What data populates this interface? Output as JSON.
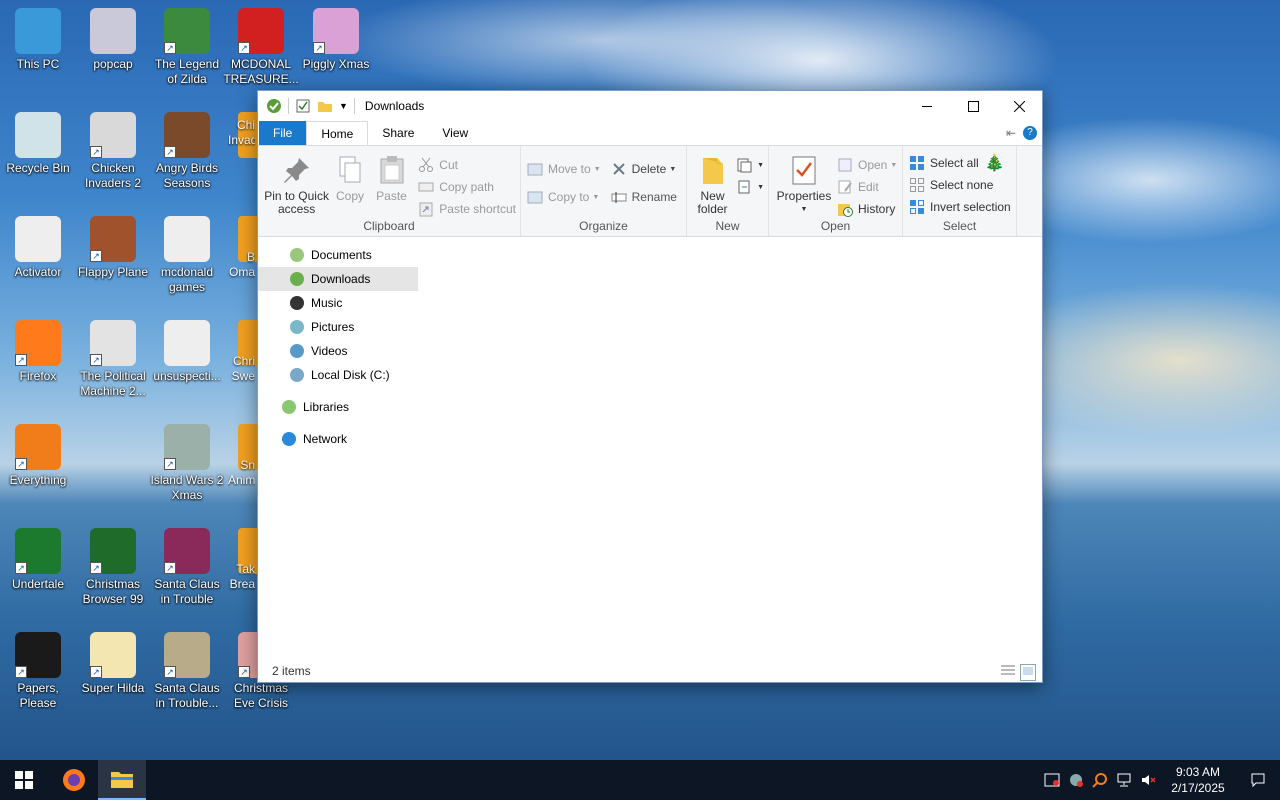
{
  "desktop": {
    "icons": [
      {
        "label": "This PC",
        "color": "#3a9ad9",
        "shortcut": false
      },
      {
        "label": "popcap",
        "color": "#c9c9d9",
        "shortcut": false
      },
      {
        "label": "The Legend of Zilda",
        "color": "#3b8a3e",
        "shortcut": true
      },
      {
        "label": "MCDONAL TREASURE...",
        "color": "#d21f1f",
        "shortcut": true
      },
      {
        "label": "Piggly Xmas",
        "color": "#d9a1d6",
        "shortcut": true
      },
      {
        "label": "Recycle Bin",
        "color": "#cfe3e8",
        "shortcut": false
      },
      {
        "label": "Chicken Invaders 2",
        "color": "#d9d9d9",
        "shortcut": true
      },
      {
        "label": "Angry Birds Seasons",
        "color": "#7a4a2a",
        "shortcut": true
      },
      {
        "label": "Activator",
        "color": "#eeeeee",
        "shortcut": false
      },
      {
        "label": "Flappy Plane",
        "color": "#a0522d",
        "shortcut": true
      },
      {
        "label": "mcdonald games",
        "color": "#eeeeee",
        "shortcut": false
      },
      {
        "label": "Firefox",
        "color": "#ff7a1a",
        "shortcut": true
      },
      {
        "label": "The Political Machine 2...",
        "color": "#e3e3e3",
        "shortcut": true
      },
      {
        "label": "unsuspecti...",
        "color": "#eeeeee",
        "shortcut": false
      },
      {
        "label": "Everything",
        "color": "#f07c1a",
        "shortcut": true
      },
      {
        "label": "Island Wars 2 Xmas",
        "color": "#9ab0a8",
        "shortcut": true
      },
      {
        "label": "Undertale",
        "color": "#1c7a2e",
        "shortcut": true
      },
      {
        "label": "Christmas Browser 99",
        "color": "#1f6b2a",
        "shortcut": true
      },
      {
        "label": "Santa Claus in Trouble",
        "color": "#8a2a5a",
        "shortcut": true
      },
      {
        "label": "Papers, Please",
        "color": "#1a1a1a",
        "shortcut": true
      },
      {
        "label": "Super Hilda",
        "color": "#f3e6b0",
        "shortcut": true
      },
      {
        "label": "Santa Claus in Trouble...",
        "color": "#b8ab8a",
        "shortcut": true
      },
      {
        "label": "Christmas Eve Crisis",
        "color": "#e0a0a0",
        "shortcut": true
      }
    ],
    "partial_labels": [
      "Chi",
      "Invad",
      "B",
      "Oma",
      "Chri",
      "Swe",
      "Sn",
      "Anim",
      "Tak",
      "Brea"
    ]
  },
  "explorer": {
    "title": "Downloads",
    "tabs": [
      "File",
      "Home",
      "Share",
      "View"
    ],
    "active_tab": "Home",
    "ribbon": {
      "clipboard": {
        "label": "Clipboard",
        "pin": "Pin to Quick access",
        "copy": "Copy",
        "paste": "Paste",
        "cut": "Cut",
        "copy_path": "Copy path",
        "paste_shortcut": "Paste shortcut"
      },
      "organize": {
        "label": "Organize",
        "move_to": "Move to",
        "copy_to": "Copy to",
        "delete": "Delete",
        "rename": "Rename"
      },
      "new": {
        "label": "New",
        "new_folder": "New folder"
      },
      "open": {
        "label": "Open",
        "properties": "Properties",
        "open": "Open",
        "edit": "Edit",
        "history": "History"
      },
      "select": {
        "label": "Select",
        "select_all": "Select all",
        "select_none": "Select none",
        "invert": "Invert selection"
      }
    },
    "nav": [
      {
        "label": "Documents",
        "selected": false,
        "top": false,
        "icon": "documents-icon"
      },
      {
        "label": "Downloads",
        "selected": true,
        "top": false,
        "icon": "downloads-icon"
      },
      {
        "label": "Music",
        "selected": false,
        "top": false,
        "icon": "music-icon"
      },
      {
        "label": "Pictures",
        "selected": false,
        "top": false,
        "icon": "pictures-icon"
      },
      {
        "label": "Videos",
        "selected": false,
        "top": false,
        "icon": "videos-icon"
      },
      {
        "label": "Local Disk (C:)",
        "selected": false,
        "top": false,
        "icon": "disk-icon"
      },
      {
        "label": "Libraries",
        "selected": false,
        "top": true,
        "icon": "libraries-icon"
      },
      {
        "label": "Network",
        "selected": false,
        "top": true,
        "icon": "network-icon"
      }
    ],
    "status": "2 items"
  },
  "taskbar": {
    "time": "9:03 AM",
    "date": "2/17/2025"
  },
  "colors": {
    "file_tab": "#1979ca",
    "taskbar": "#0c1624",
    "accent": "#1979ca"
  }
}
